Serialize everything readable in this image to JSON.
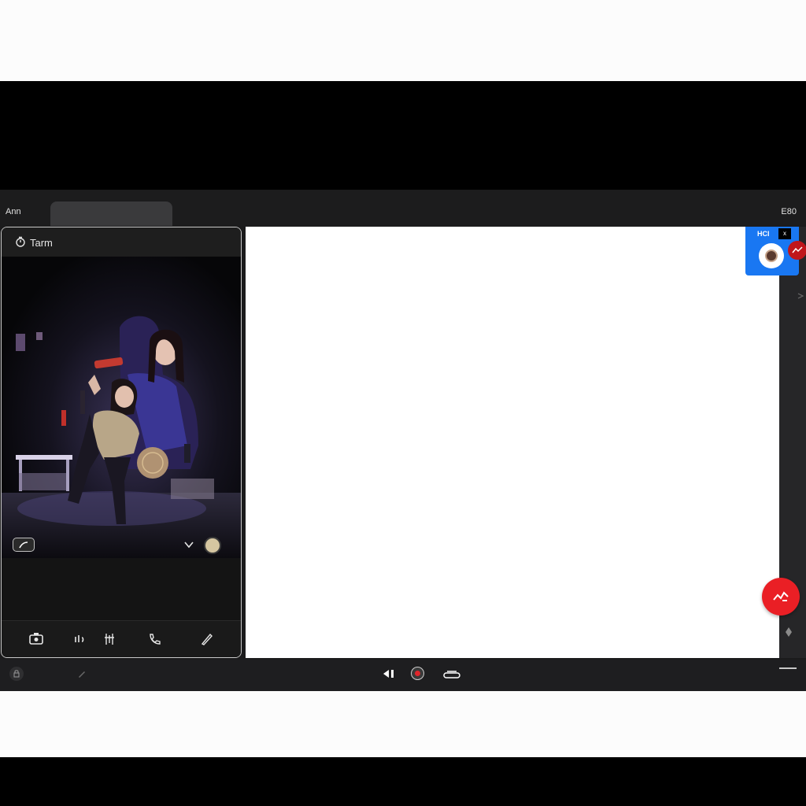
{
  "app": {
    "title": "Ann",
    "top_right_label": "E80"
  },
  "left_panel": {
    "header_title": "Tarm",
    "header_icon": "timer-icon",
    "video": {
      "pill_icon": "phone-icon",
      "chevron_icon": "chevron-down-icon",
      "disc_icon": "avatar-disc-icon"
    },
    "toolbar": {
      "icons": [
        "camera-icon",
        "audio-icon",
        "grid-icon",
        "call-icon",
        "pen-icon"
      ]
    }
  },
  "blue_card": {
    "label": "HCI",
    "mini_label": "x"
  },
  "bottom_bar": {
    "icons": [
      "lock-icon",
      "pen-icon",
      "previous-icon",
      "record-icon",
      "stack-icon"
    ]
  },
  "colors": {
    "accent_blue": "#1977f2",
    "alert_red": "#ea1f25",
    "panel_dark": "#1b1b1c"
  }
}
